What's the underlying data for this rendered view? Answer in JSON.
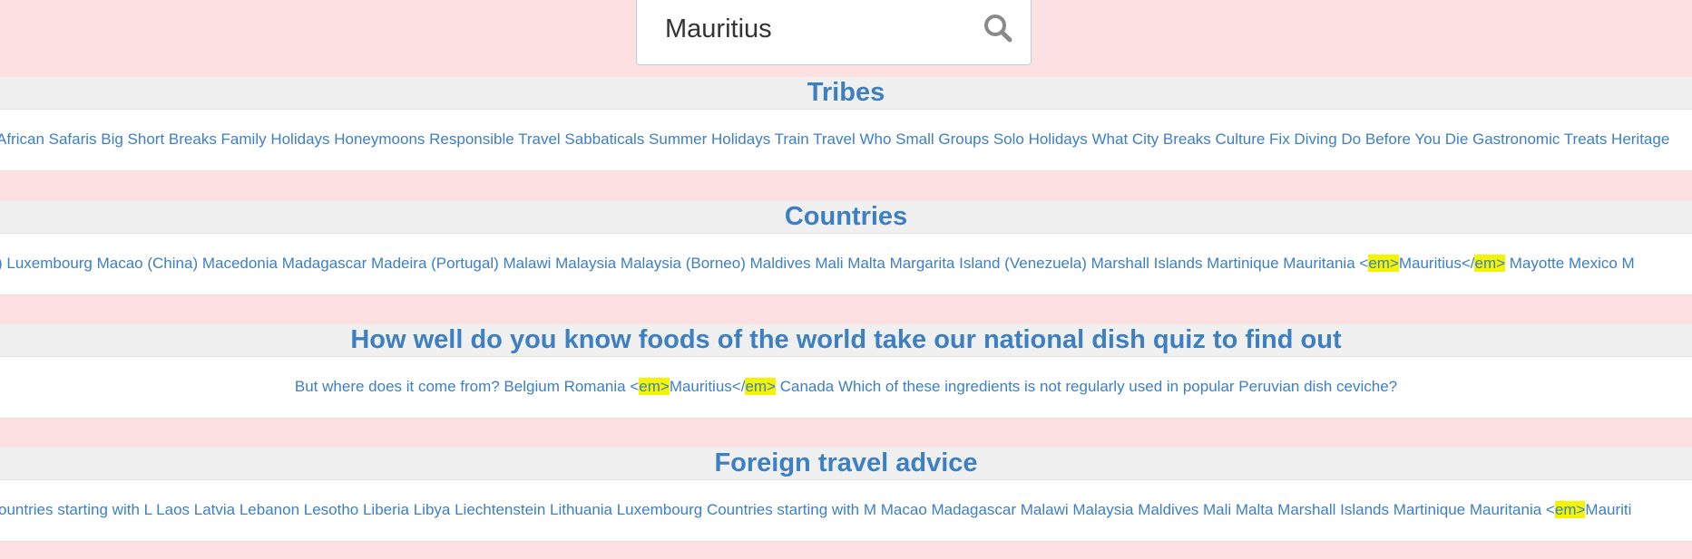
{
  "search": {
    "value": "Mauritius"
  },
  "sections": [
    {
      "title": "Tribes",
      "parts": [
        {
          "text": "African Safaris Big Short Breaks Family Holidays Honeymoons Responsible Travel Sabbaticals Summer Holidays Train Travel Who Small Groups Solo Holidays What City Breaks Culture Fix Diving Do Before You Die Gastronomic Treats Heritage"
        }
      ]
    },
    {
      "title": "Countries",
      "parts": [
        {
          "text": ") Luxembourg Macao (China) Macedonia Madagascar Madeira (Portugal) Malawi Malaysia Malaysia (Borneo) Maldives Mali Malta Margarita Island (Venezuela) Marshall Islands Martinique Mauritania <"
        },
        {
          "text": "em>",
          "hl": true
        },
        {
          "text": "Mauritius</"
        },
        {
          "text": "em>",
          "hl": true
        },
        {
          "text": " Mayotte Mexico M"
        }
      ]
    },
    {
      "title": "How well do you know foods of the world take our national dish quiz to find out",
      "parts": [
        {
          "text": "But where does it come from? Belgium Romania <"
        },
        {
          "text": "em>",
          "hl": true
        },
        {
          "text": "Mauritius</"
        },
        {
          "text": "em>",
          "hl": true
        },
        {
          "text": " Canada Which of these ingredients is not regularly used in popular Peruvian dish ceviche?"
        }
      ]
    },
    {
      "title": "Foreign travel advice",
      "parts": [
        {
          "text": "ountries starting with L Laos Latvia Lebanon Lesotho Liberia Libya Liechtenstein Lithuania Luxembourg Countries starting with M Macao Madagascar Malawi Malaysia Maldives Mali Malta Marshall Islands Martinique Mauritania <"
        },
        {
          "text": "em>",
          "hl": true
        },
        {
          "text": "Mauriti"
        }
      ]
    }
  ],
  "colors": {
    "background": "#fde0e2",
    "accent": "#3d7fc3",
    "highlight": "#f3f500",
    "header_bg": "#f0f0f0"
  },
  "icons": {
    "search": "search-icon"
  }
}
